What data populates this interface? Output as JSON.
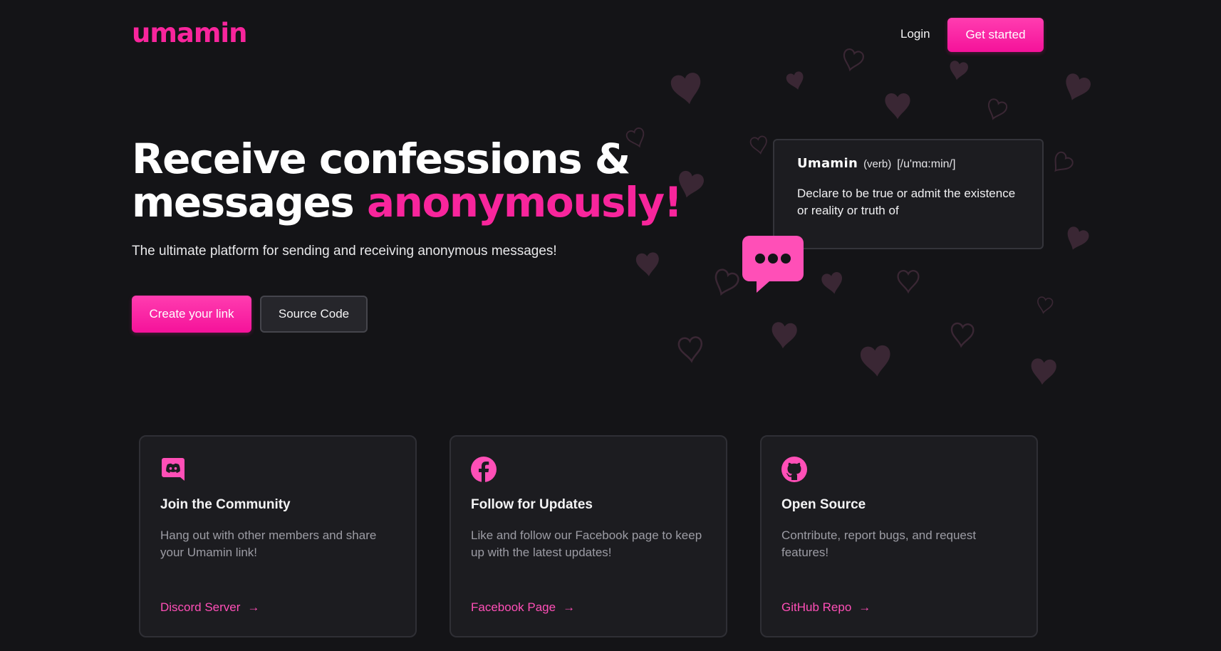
{
  "brand": {
    "logo": "umamin",
    "accent_color": "#f8259c"
  },
  "nav": {
    "login_label": "Login",
    "get_started_label": "Get started"
  },
  "hero": {
    "title_line1": "Receive confessions &",
    "title_line2_plain": "messages ",
    "title_line2_accent": "anonymously!",
    "subtitle": "The ultimate platform for sending and receiving anonymous messages!",
    "primary_cta": "Create your link",
    "secondary_cta": "Source Code"
  },
  "definition": {
    "word": "Umamin",
    "part_of_speech": "(verb)",
    "phonetic": "[/u'mɑ:min/]",
    "meaning": "Declare to be true or admit the existence or reality or truth of"
  },
  "cards": [
    {
      "icon": "discord-icon",
      "title": "Join the Community",
      "description": "Hang out with other members and share your Umamin link!",
      "link_label": "Discord Server",
      "arrow": "→"
    },
    {
      "icon": "facebook-icon",
      "title": "Follow for Updates",
      "description": "Like and follow our Facebook page to keep up with the latest updates!",
      "link_label": "Facebook Page",
      "arrow": "→"
    },
    {
      "icon": "github-icon",
      "title": "Open Source",
      "description": "Contribute, report bugs, and request features!",
      "link_label": "GitHub Repo",
      "arrow": "→"
    }
  ]
}
